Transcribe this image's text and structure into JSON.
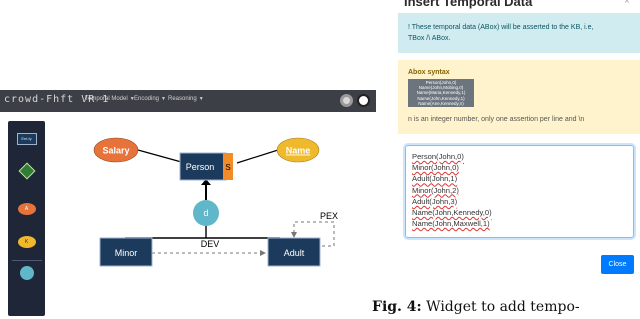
{
  "app": {
    "title": "crowd-Fhft VR 1",
    "menus": [
      {
        "label": "Temporal Model"
      },
      {
        "label": "Encoding"
      },
      {
        "label": "Reasoning"
      }
    ],
    "icons": [
      "gear-icon",
      "user-icon"
    ]
  },
  "palette": {
    "entity_label": "Ent.ty",
    "attr_label": "A",
    "key_label": "K",
    "colors": {
      "background": "#1e2638",
      "attribute": "#e8733a",
      "key": "#f0b92b",
      "relation": "#2e7d32",
      "inheritance": "#5fb7c9"
    }
  },
  "diagram": {
    "entities": [
      {
        "name": "Person",
        "marker": "S"
      },
      {
        "name": "Minor"
      },
      {
        "name": "Adult"
      }
    ],
    "attributes": [
      {
        "name": "Salary",
        "color": "#e8733a"
      },
      {
        "name": "Name",
        "color": "#f0b92b",
        "key": true
      }
    ],
    "inheritance_label": "d",
    "relations": [
      "DEV",
      "PEX"
    ],
    "colors": {
      "entity": "#1b3a5c",
      "marker": "#f28c28",
      "inheritance": "#5fb7c9"
    }
  },
  "dialog": {
    "title": "Insert Temporal Data",
    "info_lines": [
      "! These temporal data (ABox) will be asserted to the KB, i.e,",
      "TBox /\\ ABox."
    ],
    "syntax": {
      "label": "Abox syntax",
      "code_lines": [
        "Person(John,0)",
        "Name(John,Mobing,0)",
        "Name(Maria,Kennedy,1)",
        "Name(John,Kennedy,1)",
        "Name(Ane,Kennedy,n)"
      ],
      "note": "n is an integer number, only one assertion per line and \\n"
    },
    "assertions": [
      "Person(John,0)",
      "Minor(John,0)",
      "Adult(John,1)",
      "Minor(John,2)",
      "Adult(John,3)",
      "Name(John,Kennedy,0)",
      "Name(John,Maxwell,1)"
    ],
    "close_label": "Close"
  },
  "caption": {
    "label": "Fig. 4:",
    "text": "Widget to add tempo-"
  }
}
